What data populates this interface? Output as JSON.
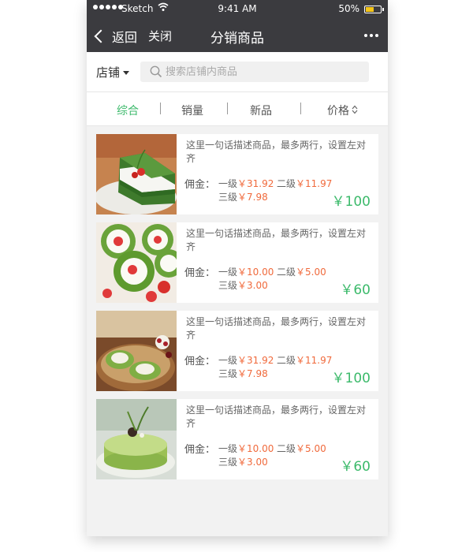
{
  "status": {
    "carrier": "Sketch",
    "time": "9:41 AM",
    "battery": "50%",
    "battery_level": 0.5
  },
  "nav": {
    "back_label": "返回",
    "close_label": "关闭",
    "title": "分销商品"
  },
  "search": {
    "store_label": "店铺",
    "placeholder": "搜索店铺内商品"
  },
  "tabs": [
    {
      "label": "综合",
      "active": true
    },
    {
      "label": "销量",
      "active": false
    },
    {
      "label": "新品",
      "active": false
    },
    {
      "label": "价格",
      "active": false
    }
  ],
  "products": [
    {
      "description": "这里一句话描述商品，最多两行，设置左对齐",
      "commission_label": "佣金：",
      "level1_label": "一级",
      "level1_amount": "￥31.92",
      "level2_label": "二级",
      "level2_amount": "￥11.97",
      "level3_label": "三级",
      "level3_amount": "￥7.98",
      "price": "￥100"
    },
    {
      "description": "这里一句话描述商品，最多两行，设置左对齐",
      "commission_label": "佣金：",
      "level1_label": "一级",
      "level1_amount": "￥10.00",
      "level2_label": "二级",
      "level2_amount": "￥5.00",
      "level3_label": "三级",
      "level3_amount": "￥3.00",
      "price": "￥60"
    },
    {
      "description": "这里一句话描述商品，最多两行，设置左对齐",
      "commission_label": "佣金：",
      "level1_label": "一级",
      "level1_amount": "￥31.92",
      "level2_label": "二级",
      "level2_amount": "￥11.97",
      "level3_label": "三级",
      "level3_amount": "￥7.98",
      "price": "￥100"
    },
    {
      "description": "这里一句话描述商品，最多两行，设置左对齐",
      "commission_label": "佣金：",
      "level1_label": "一级",
      "level1_amount": "￥10.00",
      "level2_label": "二级",
      "level2_amount": "￥5.00",
      "level3_label": "三级",
      "level3_amount": "￥3.00",
      "price": "￥60"
    }
  ],
  "colors": {
    "accent": "#3cba6b",
    "commission": "#f06a3c",
    "navbar": "#3b3b3f"
  }
}
